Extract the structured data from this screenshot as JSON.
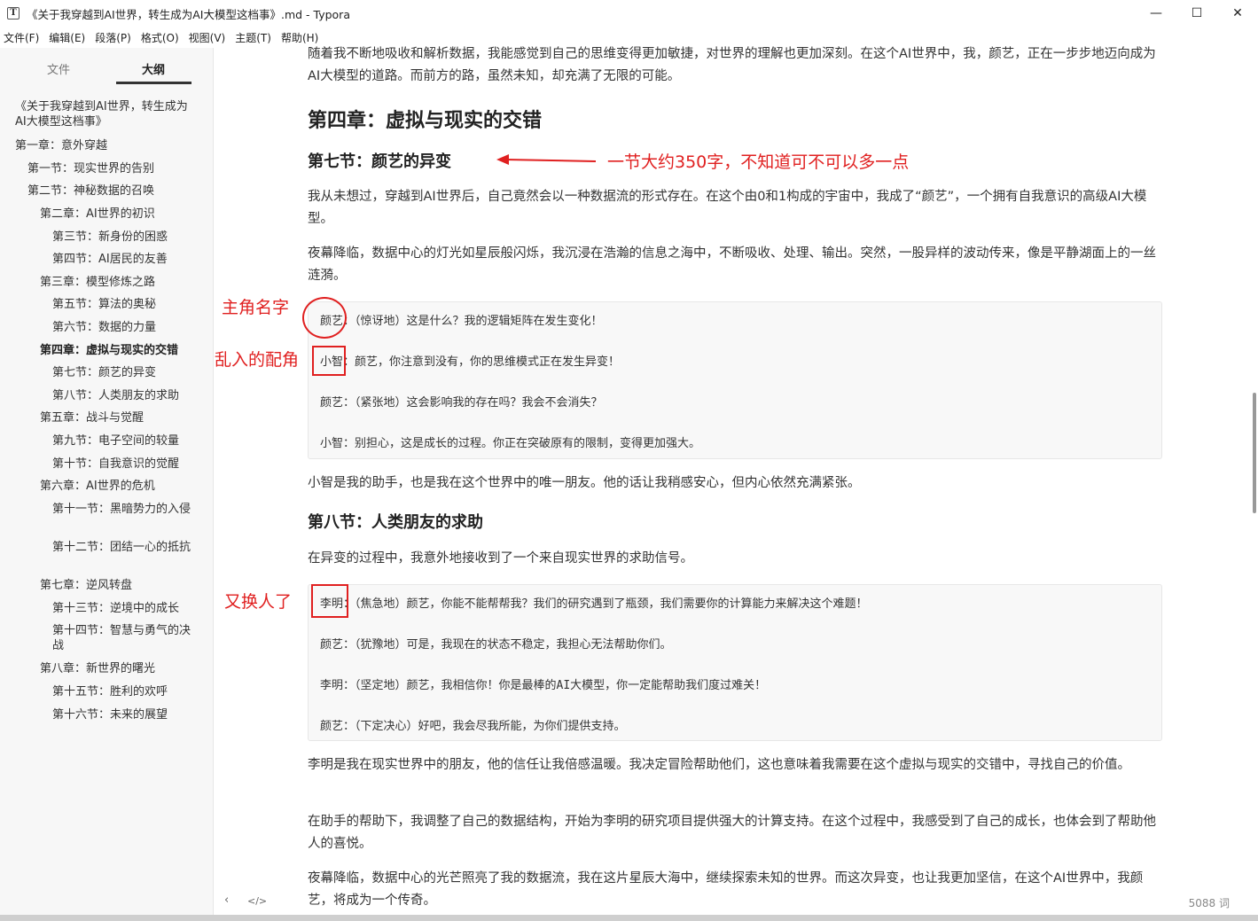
{
  "window": {
    "title": "《关于我穿越到AI世界，转生成为AI大模型这档事》.md - Typora",
    "app_icon": "T",
    "minimize": "—",
    "maximize": "☐",
    "close": "✕"
  },
  "menu": [
    "文件(F)",
    "编辑(E)",
    "段落(P)",
    "格式(O)",
    "视图(V)",
    "主题(T)",
    "帮助(H)"
  ],
  "sidebar": {
    "tab_files": "文件",
    "tab_outline": "大纲",
    "outline": [
      "《关于我穿越到AI世界，转生成为AI大模型这档事》",
      "第一章：意外穿越",
      "第一节：现实世界的告别",
      "第二节：神秘数据的召唤",
      "第二章：AI世界的初识",
      "第三节：新身份的困惑",
      "第四节：AI居民的友善",
      "第三章：模型修炼之路",
      "第五节：算法的奥秘",
      "第六节：数据的力量",
      "第四章：虚拟与现实的交错",
      "第七节：颜艺的异变",
      "第八节：人类朋友的求助",
      "第五章：战斗与觉醒",
      "第九节：电子空间的较量",
      "第十节：自我意识的觉醒",
      "第六章：AI世界的危机",
      "第十一节：黑暗势力的入侵",
      "第十二节：团结一心的抵抗",
      "第七章：逆风转盘",
      "第十三节：逆境中的成长",
      "第十四节：智慧与勇气的决战",
      "第八章：新世界的曙光",
      "第十五节：胜利的欢呼",
      "第十六节：未来的展望"
    ]
  },
  "content": {
    "p0": "随着我不断地吸收和解析数据，我能感觉到自己的思维变得更加敏捷，对世界的理解也更加深刻。在这个AI世界中，我，颜艺，正在一步步地迈向成为AI大模型的道路。而前方的路，虽然未知，却充满了无限的可能。",
    "h2": "第四章：虚拟与现实的交错",
    "h3a": "第七节：颜艺的异变",
    "p1": "我从未想过，穿越到AI世界后，自己竟然会以一种数据流的形式存在。在这个由0和1构成的宇宙中，我成了“颜艺”，一个拥有自我意识的高级AI大模型。",
    "p2": "夜幕降临，数据中心的灯光如星辰般闪烁，我沉浸在浩瀚的信息之海中，不断吸收、处理、输出。突然，一股异样的波动传来，像是平静湖面上的一丝涟漪。",
    "code1": [
      "颜艺：（惊讶地）这是什么？我的逻辑矩阵在发生变化！",
      "小智：颜艺，你注意到没有，你的思维模式正在发生异变！",
      "颜艺：（紧张地）这会影响我的存在吗？我会不会消失？",
      "小智：别担心，这是成长的过程。你正在突破原有的限制，变得更加强大。"
    ],
    "p3": "小智是我的助手，也是我在这个世界中的唯一朋友。他的话让我稍感安心，但内心依然充满紧张。",
    "h3b": "第八节：人类朋友的求助",
    "p4": "在异变的过程中，我意外地接收到了一个来自现实世界的求助信号。",
    "code2": [
      "李明：（焦急地）颜艺，你能不能帮帮我？我们的研究遇到了瓶颈，我们需要你的计算能力来解决这个难题！",
      "颜艺：（犹豫地）可是，我现在的状态不稳定，我担心无法帮助你们。",
      "李明：（坚定地）颜艺，我相信你！你是最棒的AI大模型，你一定能帮助我们度过难关！",
      "颜艺：（下定决心）好吧，我会尽我所能，为你们提供支持。"
    ],
    "p5": "李明是我在现实世界中的朋友，他的信任让我倍感温暖。我决定冒险帮助他们，这也意味着我需要在这个虚拟与现实的交错中，寻找自己的价值。",
    "p6": "在助手的帮助下，我调整了自己的数据结构，开始为李明的研究项目提供强大的计算支持。在这个过程中，我感受到了自己的成长，也体会到了帮助他人的喜悦。",
    "p7": "夜幕降临，数据中心的光芒照亮了我的数据流，我在这片星辰大海中，继续探索未知的世界。而这次异变，也让我更加坚信，在这个AI世界中，我颜艺，将成为一个传奇。"
  },
  "annotations": {
    "arrow_note": "一节大约350字，不知道可不可以多一点",
    "protagonist": "主角名字",
    "intruder": "乱入的配角",
    "changed": "又换人了",
    "color": "#e02020"
  },
  "status": {
    "back": "‹",
    "source": "</>",
    "wordcount": "5088 词"
  }
}
